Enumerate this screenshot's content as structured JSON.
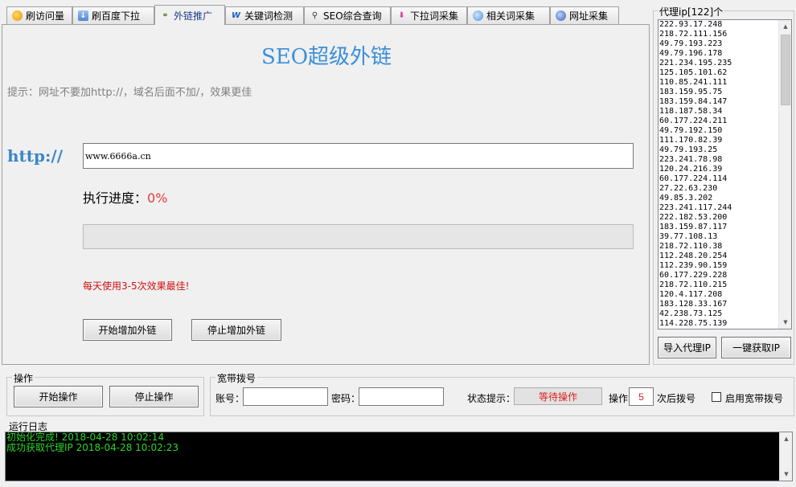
{
  "tabs": [
    {
      "label": "刷访问量",
      "icon": "coin-icon"
    },
    {
      "label": "刷百度下拉",
      "icon": "download-icon"
    },
    {
      "label": "外链推广",
      "icon": "link-icon",
      "active": true
    },
    {
      "label": "关键词检测",
      "icon": "word-icon"
    },
    {
      "label": "SEO综合查询",
      "icon": "search-icon"
    },
    {
      "label": "下拉词采集",
      "icon": "arrow-down-icon"
    },
    {
      "label": "相关词采集",
      "icon": "chat-icon"
    },
    {
      "label": "网址采集",
      "icon": "globe-icon"
    }
  ],
  "main": {
    "title": "SEO超级外链",
    "hint": "提示：网址不要加http://，域名后面不加/，效果更佳",
    "http_label": "http://",
    "url_value": "www.6666a.cn",
    "progress_label": "执行进度：",
    "progress_value": "0%",
    "progress_fraction": 0,
    "daily_tip": "每天使用3-5次效果最佳!",
    "start_button": "开始增加外链",
    "stop_button": "停止增加外链"
  },
  "proxy": {
    "title": "代理ip[122]个",
    "items": [
      "222.93.17.248",
      "218.72.111.156",
      "49.79.193.223",
      "49.79.196.178",
      "221.234.195.235",
      "125.105.101.62",
      "110.85.241.111",
      "183.159.95.75",
      "183.159.84.147",
      "118.187.58.34",
      "60.177.224.211",
      "49.79.192.150",
      "111.170.82.39",
      "49.79.193.25",
      "223.241.78.98",
      "120.24.216.39",
      "60.177.224.114",
      "27.22.63.230",
      "49.85.3.202",
      "223.241.117.244",
      "222.182.53.200",
      "183.159.87.117",
      "39.77.108.13",
      "218.72.110.38",
      "112.248.20.254",
      "112.239.90.159",
      "60.177.229.228",
      "218.72.110.215",
      "120.4.117.208",
      "183.128.33.167",
      "42.238.73.125",
      "114.228.75.139"
    ],
    "import_button": "导入代理IP",
    "fetch_button": "一键获取IP"
  },
  "operation": {
    "title": "操作",
    "start_button": "开始操作",
    "stop_button": "停止操作"
  },
  "broadband": {
    "title": "宽带拨号",
    "account_label": "账号：",
    "account_value": "",
    "password_label": "密码：",
    "password_value": "",
    "status_label": "状态提示：",
    "status_value": "等待操作",
    "op_label": "操作",
    "op_count": "5",
    "op_suffix": "次后拨号",
    "enable_label": "启用宽带拨号",
    "enable_checked": false
  },
  "log": {
    "title": "运行日志",
    "lines": [
      "初始化完成!  2018-04-28 10:02:14",
      "成功获取代理IP 2018-04-28 10:02:23"
    ]
  },
  "colors": {
    "title_blue": "#3b8fd9",
    "progress_red": "#e23b3b",
    "tip_red": "#d01010",
    "log_green": "#2bd62b"
  }
}
